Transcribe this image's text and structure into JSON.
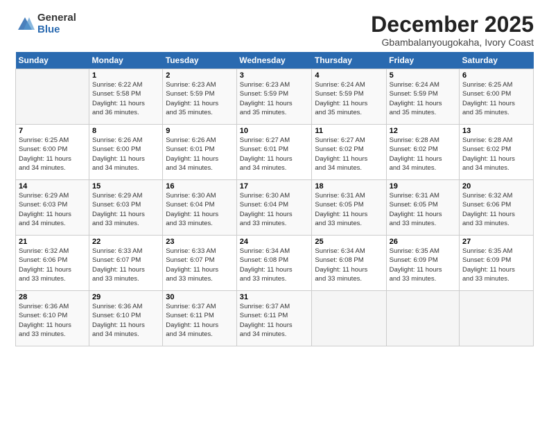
{
  "logo": {
    "general": "General",
    "blue": "Blue"
  },
  "title": "December 2025",
  "location": "Gbambalanyougokaha, Ivory Coast",
  "header_days": [
    "Sunday",
    "Monday",
    "Tuesday",
    "Wednesday",
    "Thursday",
    "Friday",
    "Saturday"
  ],
  "weeks": [
    [
      {
        "day": "",
        "info": ""
      },
      {
        "day": "1",
        "info": "Sunrise: 6:22 AM\nSunset: 5:58 PM\nDaylight: 11 hours\nand 36 minutes."
      },
      {
        "day": "2",
        "info": "Sunrise: 6:23 AM\nSunset: 5:59 PM\nDaylight: 11 hours\nand 35 minutes."
      },
      {
        "day": "3",
        "info": "Sunrise: 6:23 AM\nSunset: 5:59 PM\nDaylight: 11 hours\nand 35 minutes."
      },
      {
        "day": "4",
        "info": "Sunrise: 6:24 AM\nSunset: 5:59 PM\nDaylight: 11 hours\nand 35 minutes."
      },
      {
        "day": "5",
        "info": "Sunrise: 6:24 AM\nSunset: 5:59 PM\nDaylight: 11 hours\nand 35 minutes."
      },
      {
        "day": "6",
        "info": "Sunrise: 6:25 AM\nSunset: 6:00 PM\nDaylight: 11 hours\nand 35 minutes."
      }
    ],
    [
      {
        "day": "7",
        "info": "Sunrise: 6:25 AM\nSunset: 6:00 PM\nDaylight: 11 hours\nand 34 minutes."
      },
      {
        "day": "8",
        "info": "Sunrise: 6:26 AM\nSunset: 6:00 PM\nDaylight: 11 hours\nand 34 minutes."
      },
      {
        "day": "9",
        "info": "Sunrise: 6:26 AM\nSunset: 6:01 PM\nDaylight: 11 hours\nand 34 minutes."
      },
      {
        "day": "10",
        "info": "Sunrise: 6:27 AM\nSunset: 6:01 PM\nDaylight: 11 hours\nand 34 minutes."
      },
      {
        "day": "11",
        "info": "Sunrise: 6:27 AM\nSunset: 6:02 PM\nDaylight: 11 hours\nand 34 minutes."
      },
      {
        "day": "12",
        "info": "Sunrise: 6:28 AM\nSunset: 6:02 PM\nDaylight: 11 hours\nand 34 minutes."
      },
      {
        "day": "13",
        "info": "Sunrise: 6:28 AM\nSunset: 6:02 PM\nDaylight: 11 hours\nand 34 minutes."
      }
    ],
    [
      {
        "day": "14",
        "info": "Sunrise: 6:29 AM\nSunset: 6:03 PM\nDaylight: 11 hours\nand 34 minutes."
      },
      {
        "day": "15",
        "info": "Sunrise: 6:29 AM\nSunset: 6:03 PM\nDaylight: 11 hours\nand 33 minutes."
      },
      {
        "day": "16",
        "info": "Sunrise: 6:30 AM\nSunset: 6:04 PM\nDaylight: 11 hours\nand 33 minutes."
      },
      {
        "day": "17",
        "info": "Sunrise: 6:30 AM\nSunset: 6:04 PM\nDaylight: 11 hours\nand 33 minutes."
      },
      {
        "day": "18",
        "info": "Sunrise: 6:31 AM\nSunset: 6:05 PM\nDaylight: 11 hours\nand 33 minutes."
      },
      {
        "day": "19",
        "info": "Sunrise: 6:31 AM\nSunset: 6:05 PM\nDaylight: 11 hours\nand 33 minutes."
      },
      {
        "day": "20",
        "info": "Sunrise: 6:32 AM\nSunset: 6:06 PM\nDaylight: 11 hours\nand 33 minutes."
      }
    ],
    [
      {
        "day": "21",
        "info": "Sunrise: 6:32 AM\nSunset: 6:06 PM\nDaylight: 11 hours\nand 33 minutes."
      },
      {
        "day": "22",
        "info": "Sunrise: 6:33 AM\nSunset: 6:07 PM\nDaylight: 11 hours\nand 33 minutes."
      },
      {
        "day": "23",
        "info": "Sunrise: 6:33 AM\nSunset: 6:07 PM\nDaylight: 11 hours\nand 33 minutes."
      },
      {
        "day": "24",
        "info": "Sunrise: 6:34 AM\nSunset: 6:08 PM\nDaylight: 11 hours\nand 33 minutes."
      },
      {
        "day": "25",
        "info": "Sunrise: 6:34 AM\nSunset: 6:08 PM\nDaylight: 11 hours\nand 33 minutes."
      },
      {
        "day": "26",
        "info": "Sunrise: 6:35 AM\nSunset: 6:09 PM\nDaylight: 11 hours\nand 33 minutes."
      },
      {
        "day": "27",
        "info": "Sunrise: 6:35 AM\nSunset: 6:09 PM\nDaylight: 11 hours\nand 33 minutes."
      }
    ],
    [
      {
        "day": "28",
        "info": "Sunrise: 6:36 AM\nSunset: 6:10 PM\nDaylight: 11 hours\nand 33 minutes."
      },
      {
        "day": "29",
        "info": "Sunrise: 6:36 AM\nSunset: 6:10 PM\nDaylight: 11 hours\nand 34 minutes."
      },
      {
        "day": "30",
        "info": "Sunrise: 6:37 AM\nSunset: 6:11 PM\nDaylight: 11 hours\nand 34 minutes."
      },
      {
        "day": "31",
        "info": "Sunrise: 6:37 AM\nSunset: 6:11 PM\nDaylight: 11 hours\nand 34 minutes."
      },
      {
        "day": "",
        "info": ""
      },
      {
        "day": "",
        "info": ""
      },
      {
        "day": "",
        "info": ""
      }
    ]
  ]
}
